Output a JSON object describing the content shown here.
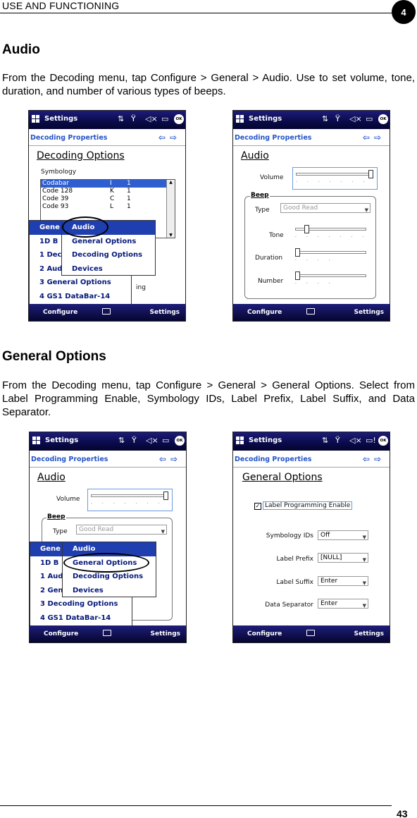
{
  "header": {
    "title": "USE AND FUNCTIONING",
    "chapter": "4"
  },
  "audio_section": {
    "title": "Audio",
    "text": "From the Decoding menu, tap Configure > General > Audio. Use to set volume, tone, duration, and number of various types of beeps."
  },
  "general_section": {
    "title": "General Options",
    "text": "From the Decoding menu, tap Configure > General > General Options. Select from Label Programming Enable, Symbology IDs, Label Prefix, Label Suffix, and Data Separator."
  },
  "device": {
    "app_title": "Settings",
    "ok": "OK",
    "subtitle": "Decoding Properties",
    "bottom_left": "Configure",
    "bottom_right": "Settings"
  },
  "screen1": {
    "page_title": "Decoding Options",
    "symbology_label": "Symbology",
    "rows": [
      {
        "name": "Codabar",
        "id": "I",
        "n": "1"
      },
      {
        "name": "Code 128",
        "id": "K",
        "n": "1"
      },
      {
        "name": "Code 39",
        "id": "C",
        "n": "1"
      },
      {
        "name": "Code 93",
        "id": "L",
        "n": "1"
      }
    ],
    "main_menu": [
      "General",
      "1D Barcodes",
      "1 Decoding Options",
      "2 Audio",
      "3 General Options",
      "4 GS1 DataBar-14"
    ],
    "main_menu_visible": [
      "Gene",
      "1D B",
      "1 Dec",
      "2 Aud",
      "3 General Options",
      "4 GS1 DataBar-14"
    ],
    "hidden_text": "ing",
    "sub_menu": [
      "Audio",
      "General Options",
      "Decoding Options",
      "Devices"
    ]
  },
  "screen2": {
    "page_title": "Audio",
    "volume": "Volume",
    "beep": "Beep",
    "type_label": "Type",
    "type_value": "Good Read",
    "tone": "Tone",
    "duration": "Duration",
    "number": "Number",
    "volume_level": 1.0,
    "tone_level": 0.14,
    "duration_level": 0.0,
    "number_level": 0.0
  },
  "screen3": {
    "page_title": "Audio",
    "volume": "Volume",
    "beep": "Beep",
    "type_label": "Type",
    "type_value": "Good Read",
    "main_menu_visible": [
      "Gene",
      "1D B",
      "1 Aud",
      "2 Gen",
      "3 Decoding Options",
      "4 GS1 DataBar-14"
    ],
    "sub_menu": [
      "Audio",
      "General Options",
      "Decoding Options",
      "Devices"
    ]
  },
  "screen4": {
    "page_title": "General Options",
    "checkbox_label": "Label Programming Enable",
    "checked": true,
    "fields": [
      {
        "label": "Symbology IDs",
        "value": "Off"
      },
      {
        "label": "Label Prefix",
        "value": "[NULL]"
      },
      {
        "label": "Label Suffix",
        "value": "Enter"
      },
      {
        "label": "Data Separator",
        "value": "Enter"
      }
    ]
  },
  "footer": {
    "page_number": "43"
  }
}
